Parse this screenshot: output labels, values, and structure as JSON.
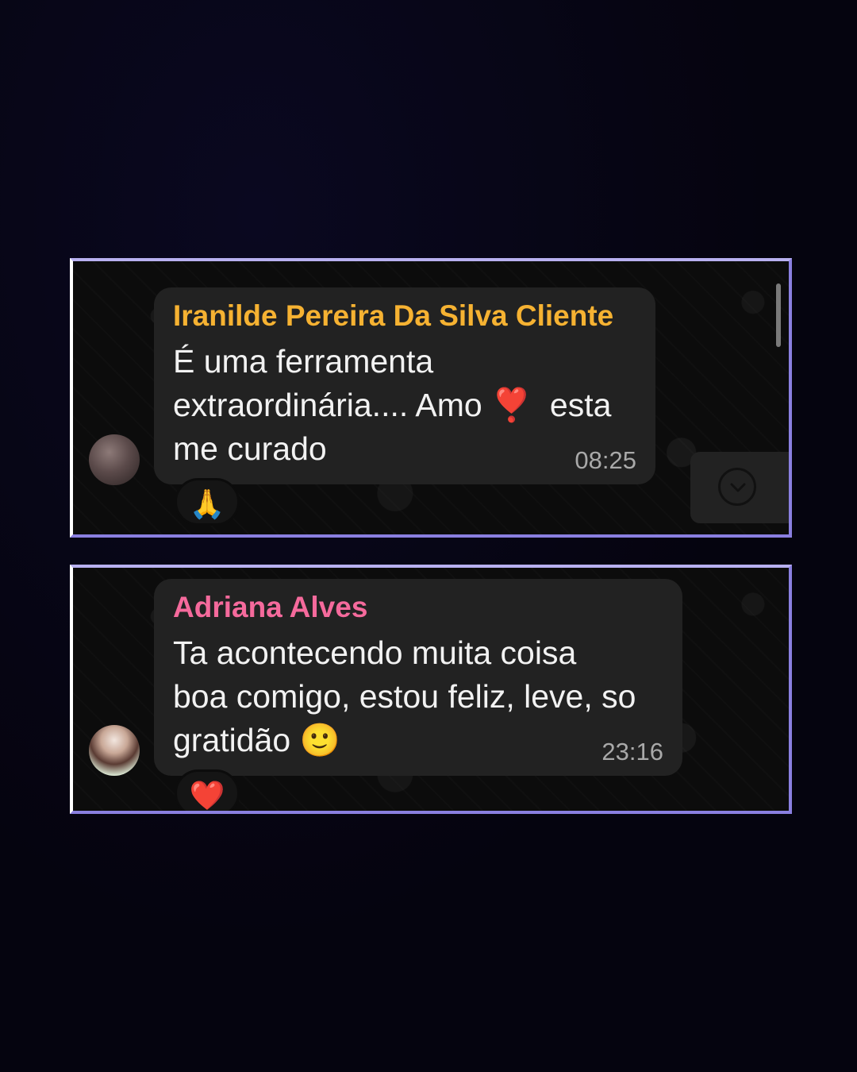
{
  "messages": [
    {
      "sender": "Iranilde Pereira Da Silva Cliente",
      "text": "É uma ferramenta\nextraordinária.... Amo ❣️  esta\nme curado",
      "time": "08:25",
      "reaction": "🙏"
    },
    {
      "sender": "Adriana Alves",
      "text": "Ta acontecendo muita coisa\nboa comigo, estou feliz, leve, so\ngratidão 🙂",
      "time": "23:16",
      "reaction": "❤️"
    }
  ],
  "colors": {
    "background": "#05040f",
    "bubble": "#222222",
    "sender_one": "#f6b232",
    "sender_two": "#f56a9c",
    "frame_border": "#8a7fe0"
  },
  "icons": {
    "scroll_down": "chevron-down-icon"
  }
}
